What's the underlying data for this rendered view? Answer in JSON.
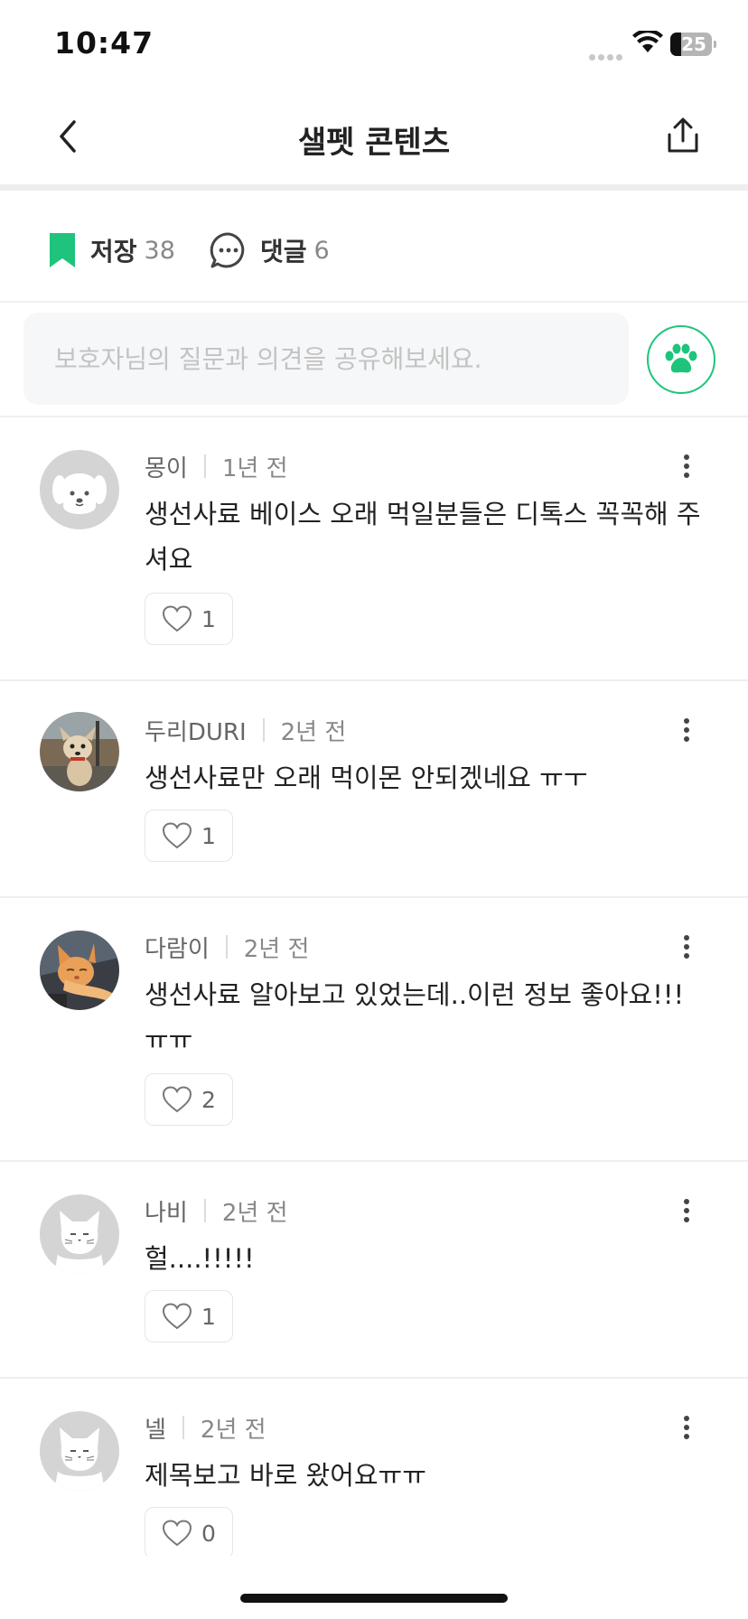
{
  "status_bar": {
    "time": "10:47",
    "battery": "25"
  },
  "header": {
    "title": "샐펫 콘텐츠"
  },
  "stats": {
    "save_label": "저장",
    "save_count": "38",
    "comment_label": "댓글",
    "comment_count": "6"
  },
  "comment_input": {
    "placeholder": "보호자님의 질문과 의견을 공유해보세요."
  },
  "comments": [
    {
      "author": "몽이",
      "time": "1년 전",
      "text": "생선사료 베이스 오래 먹일분들은 디톡스 꼭꼭해 주셔요",
      "likes": "1",
      "avatar": "dog-default-avatar"
    },
    {
      "author": "두리DURI",
      "time": "2년 전",
      "text": "생선사료만 오래 먹이몬 안되겠네요 ㅠㅜ",
      "likes": "1",
      "avatar": "dog-photo-avatar"
    },
    {
      "author": "다람이",
      "time": "2년 전",
      "text": "생선사료 알아보고 있었는데..이런 정보 좋아요!!! ㅠㅠ",
      "likes": "2",
      "avatar": "cat-photo-avatar"
    },
    {
      "author": "나비",
      "time": "2년 전",
      "text": "헐....!!!!!",
      "likes": "1",
      "avatar": "cat-default-avatar"
    },
    {
      "author": "넬",
      "time": "2년 전",
      "text": "제목보고 바로 왔어요ㅠㅠ",
      "likes": "0",
      "avatar": "cat-default-avatar"
    }
  ],
  "colors": {
    "accent": "#1ec47b",
    "text": "#222222",
    "muted": "#888888"
  }
}
